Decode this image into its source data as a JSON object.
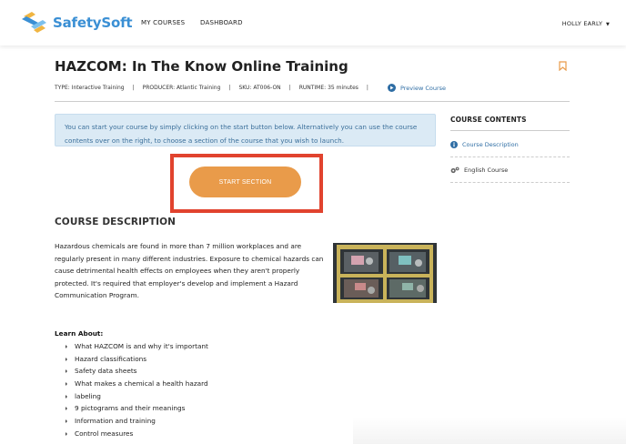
{
  "brand": {
    "name": "SafetySoft"
  },
  "nav": {
    "my_courses": "MY COURSES",
    "dashboard": "DASHBOARD",
    "user": "HOLLY EARLY"
  },
  "course": {
    "title": "HAZCOM: In The Know Online Training",
    "type": "TYPE: Interactive Training",
    "producer": "PRODUCER: Atlantic Training",
    "sku": "SKU: AT006-ON",
    "runtime": "RUNTIME: 35 minutes",
    "preview_label": "Preview Course"
  },
  "info": "You can start your course by simply clicking on the start button below. Alternatively you can use the course contents over on the right, to choose a section of the course that you wish to launch.",
  "start_button": "START SECTION",
  "description": {
    "heading": "COURSE DESCRIPTION",
    "body": "Hazardous chemicals are found in more than 7 million workplaces and are regularly present in many different industries. Exposure to chemical hazards can cause detrimental health effects on employees when they aren't properly protected. It's required that employer's develop and implement a Hazard Communication Program."
  },
  "learn": {
    "title": "Learn About:",
    "items": [
      "What HAZCOM is and why it's important",
      "Hazard classifications",
      "Safety data sheets",
      "What makes a chemical a health hazard",
      "labeling",
      "9 pictograms and their meanings",
      "Information and training",
      "Control measures"
    ]
  },
  "sidebar": {
    "title": "COURSE CONTENTS",
    "items": [
      {
        "label": "Course Description"
      },
      {
        "label": "English Course"
      }
    ]
  },
  "colors": {
    "accent": "#e99b4a",
    "link": "#2e6da4",
    "brand": "#3a8fd4",
    "highlight": "#e1432e",
    "info_bg": "#dbeaf5"
  }
}
